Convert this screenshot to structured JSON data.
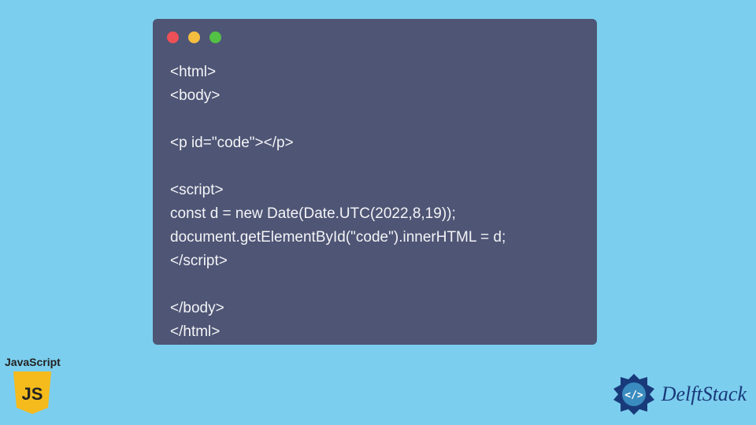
{
  "code": {
    "lines": [
      "<html>",
      "<body>",
      "",
      "<p id=\"code\"></p>",
      "",
      "<script>",
      "const d = new Date(Date.UTC(2022,8,19));",
      "document.getElementById(\"code\").innerHTML = d;",
      "</script>",
      "",
      "</body>",
      "</html>"
    ]
  },
  "badges": {
    "js_label": "JavaScript",
    "js_text": "JS",
    "brand": "DelftStack"
  },
  "colors": {
    "background": "#7cceee",
    "window": "#4e5575",
    "dot_red": "#ee5057",
    "dot_yellow": "#f5bd40",
    "dot_green": "#53c144",
    "js_yellow": "#f5bb1c",
    "brand_blue": "#193a7a"
  }
}
